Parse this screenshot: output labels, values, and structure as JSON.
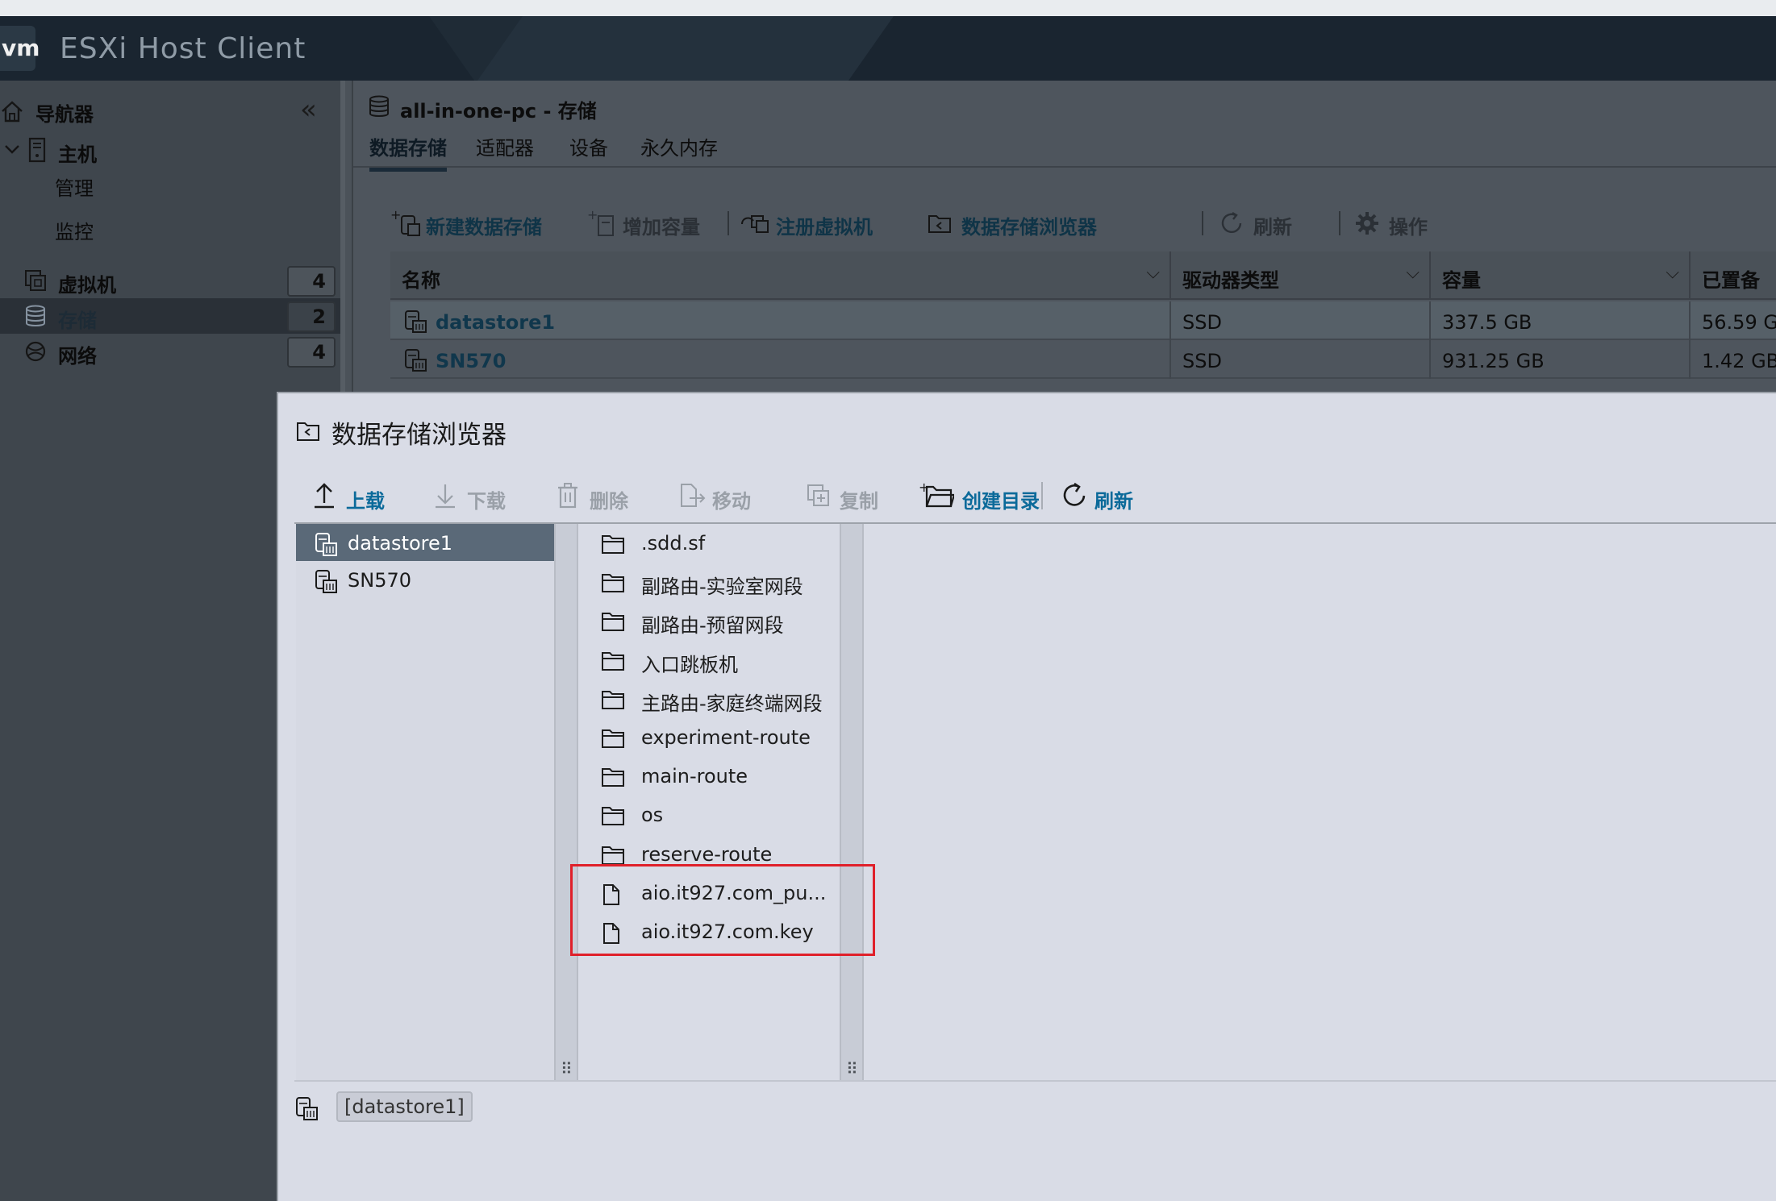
{
  "header": {
    "logo_text": "vm",
    "app_title": "ESXi Host Client"
  },
  "sidebar": {
    "navigator_label": "导航器",
    "collapse_glyph": "«",
    "host_label": "主机",
    "host_sub_items": [
      "管理",
      "监控"
    ],
    "items": [
      {
        "label": "虚拟机",
        "count": "4",
        "icon": "vm-icon"
      },
      {
        "label": "存储",
        "count": "2",
        "icon": "storage-icon",
        "active": true
      },
      {
        "label": "网络",
        "count": "4",
        "icon": "network-icon"
      }
    ]
  },
  "main": {
    "title": "all-in-one-pc - 存储",
    "tabs": [
      "数据存储",
      "适配器",
      "设备",
      "永久内存"
    ],
    "toolbar": {
      "new_datastore": "新建数据存储",
      "increase_capacity": "增加容量",
      "register_vm": "注册虚拟机",
      "datastore_browser": "数据存储浏览器",
      "refresh": "刷新",
      "actions": "操作"
    },
    "table": {
      "columns": [
        "名称",
        "驱动器类型",
        "容量",
        "已置备"
      ],
      "rows": [
        {
          "name": "datastore1",
          "drive_type": "SSD",
          "capacity": "337.5 GB",
          "provisioned": "56.59 GB"
        },
        {
          "name": "SN570",
          "drive_type": "SSD",
          "capacity": "931.25 GB",
          "provisioned": "1.42 GB"
        }
      ]
    }
  },
  "dialog": {
    "title": "数据存储浏览器",
    "toolbar": {
      "upload": "上载",
      "download": "下载",
      "delete": "删除",
      "move": "移动",
      "copy": "复制",
      "create_dir": "创建目录",
      "refresh": "刷新"
    },
    "datastores": [
      "datastore1",
      "SN570"
    ],
    "files": [
      {
        "name": ".sdd.sf",
        "type": "folder"
      },
      {
        "name": "副路由-实验室网段",
        "type": "folder"
      },
      {
        "name": "副路由-预留网段",
        "type": "folder"
      },
      {
        "name": "入口跳板机",
        "type": "folder"
      },
      {
        "name": "主路由-家庭终端网段",
        "type": "folder"
      },
      {
        "name": "experiment-route",
        "type": "folder"
      },
      {
        "name": "main-route",
        "type": "folder"
      },
      {
        "name": "os",
        "type": "folder"
      },
      {
        "name": "reserve-route",
        "type": "folder"
      },
      {
        "name": "aio.it927.com_pu...",
        "type": "file"
      },
      {
        "name": "aio.it927.com.key",
        "type": "file"
      }
    ],
    "path": "[datastore1]",
    "colors": {
      "highlight": "#e0202a",
      "link": "#0b6a9a"
    }
  }
}
